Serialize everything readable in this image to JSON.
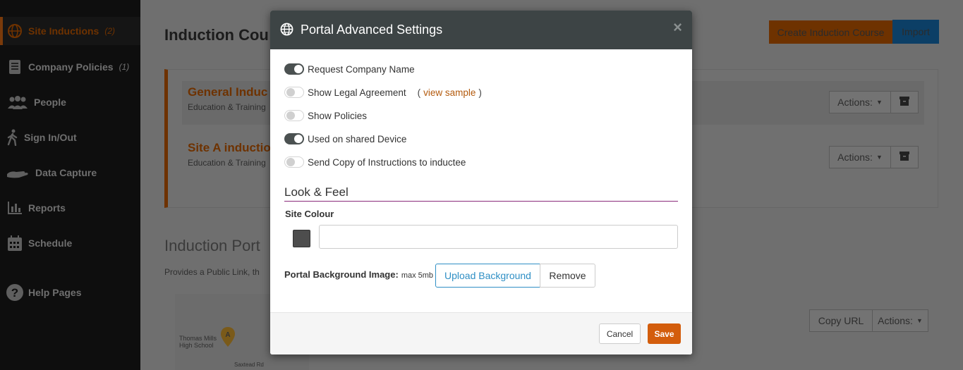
{
  "sidebar": {
    "items": [
      {
        "label": "Site Inductions",
        "count": "(2)",
        "icon": "globe-icon"
      },
      {
        "label": "Company Policies",
        "count": "(1)",
        "icon": "book-icon"
      },
      {
        "label": "People",
        "count": "",
        "icon": "people-icon"
      },
      {
        "label": "Sign In/Out",
        "count": "",
        "icon": "walking-icon"
      },
      {
        "label": "Data Capture",
        "count": "",
        "icon": "hand-icon"
      },
      {
        "label": "Reports",
        "count": "",
        "icon": "bar-chart-icon"
      },
      {
        "label": "Schedule",
        "count": "",
        "icon": "calendar-icon"
      },
      {
        "label": "Help Pages",
        "count": "",
        "icon": "question-circle-icon"
      }
    ]
  },
  "main": {
    "title": "Induction Cou",
    "create_button": "Create Induction Course",
    "import_button": "Import",
    "courses": [
      {
        "title": "General Induc",
        "subtitle": "Education & Training",
        "actions": "Actions:"
      },
      {
        "title": "Site A inductio",
        "subtitle": "Education & Training",
        "actions": "Actions:"
      }
    ],
    "portal_title": "Induction Port",
    "portal_subtitle": "Provides a Public Link, th",
    "map_label_line1": "Thomas Mills",
    "map_label_line2": "High School",
    "map_road": "Saxtead Rd",
    "copy_url": "Copy URL",
    "portal_actions": "Actions:"
  },
  "modal": {
    "title": "Portal Advanced Settings",
    "close": "×",
    "toggles": [
      {
        "label": "Request Company Name",
        "on": true
      },
      {
        "label": "Show Legal Agreement",
        "on": false
      },
      {
        "label": "Show Policies",
        "on": false
      },
      {
        "label": "Used on shared Device",
        "on": true
      },
      {
        "label": "Send Copy of Instructions to inductee",
        "on": false
      }
    ],
    "view_sample_open": "(",
    "view_sample_link": "view sample",
    "view_sample_close": ")",
    "section_title": "Look & Feel",
    "site_colour_label": "Site Colour",
    "site_colour_value": "",
    "site_colour_swatch": "#4d4d4d",
    "bg_image_label": "Portal Background Image:",
    "bg_image_note": "max 5mb",
    "upload_button": "Upload Background",
    "remove_button": "Remove",
    "cancel_button": "Cancel",
    "save_button": "Save"
  },
  "colors": {
    "accent": "#d35d0c",
    "link": "#b35a0d",
    "upload_blue": "#2f8fc5",
    "header": "#3d4445"
  }
}
